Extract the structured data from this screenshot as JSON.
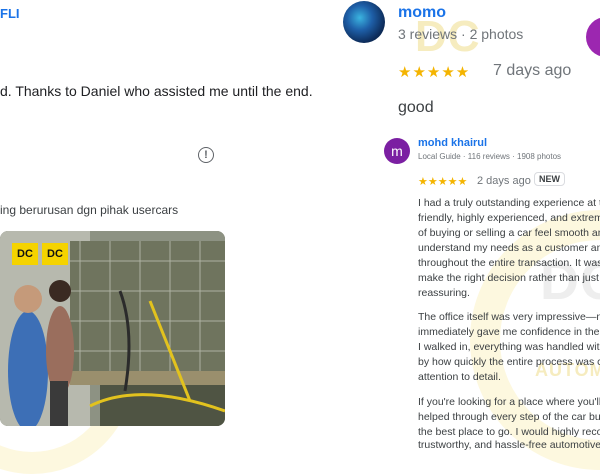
{
  "left_review": {
    "reviewer_name": "FLI",
    "text": "d. Thanks to Daniel who assisted me until the end.",
    "reply_text": "ing berurusan dgn pihak usercars",
    "photo_badges": [
      "DC",
      "DC"
    ]
  },
  "right_review": {
    "reviewer_name": "momo",
    "meta": "3 reviews · 2 photos",
    "stars": "★★★★★",
    "time": "7 days ago",
    "text": "good"
  },
  "nested_review": {
    "avatar_letter": "m",
    "reviewer_name": "mohd khairul",
    "meta": "Local Guide · 116 reviews · 1908 photos",
    "stars": "★★★★★",
    "time": "2 days ago",
    "badge": "NEW",
    "paragraph1": [
      "I had a truly outstanding experience at th",
      "friendly, highly experienced, and extreme",
      "of buying or selling a car feel smooth an",
      "understand my needs as a customer and",
      "throughout the entire transaction. It was",
      "make the right decision rather than just r",
      "reassuring."
    ],
    "paragraph2": [
      "The office itself was very impressive—ne",
      "immediately gave me confidence in the p",
      "I walked in, everything was handled with",
      "by how quickly the entire process was co",
      "attention to detail."
    ],
    "paragraph3": [
      "If you're looking for a place where you'll",
      "helped through every step of the car buy",
      "the best place to go. I would highly reco",
      "trustworthy, and hassle-free automotive"
    ]
  },
  "watermark": {
    "logo": "DC",
    "text": "AUTOMO"
  },
  "icons": {
    "info": "info-icon"
  }
}
